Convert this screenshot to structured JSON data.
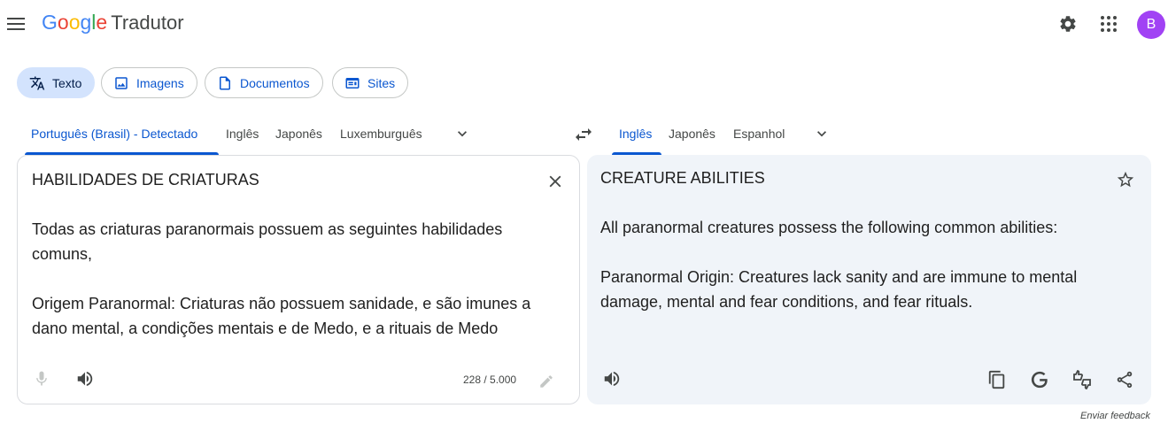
{
  "header": {
    "logo_letters": [
      {
        "ch": "G",
        "color": "#4285f4"
      },
      {
        "ch": "o",
        "color": "#ea4335"
      },
      {
        "ch": "o",
        "color": "#fbbc04"
      },
      {
        "ch": "g",
        "color": "#4285f4"
      },
      {
        "ch": "l",
        "color": "#34a853"
      },
      {
        "ch": "e",
        "color": "#ea4335"
      }
    ],
    "app_name": "Tradutor",
    "avatar_letter": "B"
  },
  "modes": {
    "text": "Texto",
    "images": "Imagens",
    "documents": "Documentos",
    "sites": "Sites"
  },
  "source_langs": [
    "Português (Brasil) - Detectado",
    "Inglês",
    "Japonês",
    "Luxemburguês"
  ],
  "target_langs": [
    "Inglês",
    "Japonês",
    "Espanhol"
  ],
  "source": {
    "text": "HABILIDADES DE CRIATURAS\n\nTodas as criaturas paranormais possuem as seguintes habilidades comuns,\n\nOrigem Paranormal: Criaturas não possuem sanidade, e são imunes a dano mental, a condições mentais e de Medo, e a rituais de Medo",
    "char_count": "228 / 5.000"
  },
  "target": {
    "text": "CREATURE ABILITIES\n\nAll paranormal creatures possess the following common abilities:\n\nParanormal Origin: Creatures lack sanity and are immune to mental damage, mental and fear conditions, and fear rituals."
  },
  "footer": {
    "feedback": "Enviar feedback"
  },
  "colors": {
    "accent": "#0b57d0",
    "active_chip_bg": "#d3e3fd",
    "target_panel_bg": "#f0f4f9",
    "avatar_bg": "#a142f4"
  }
}
